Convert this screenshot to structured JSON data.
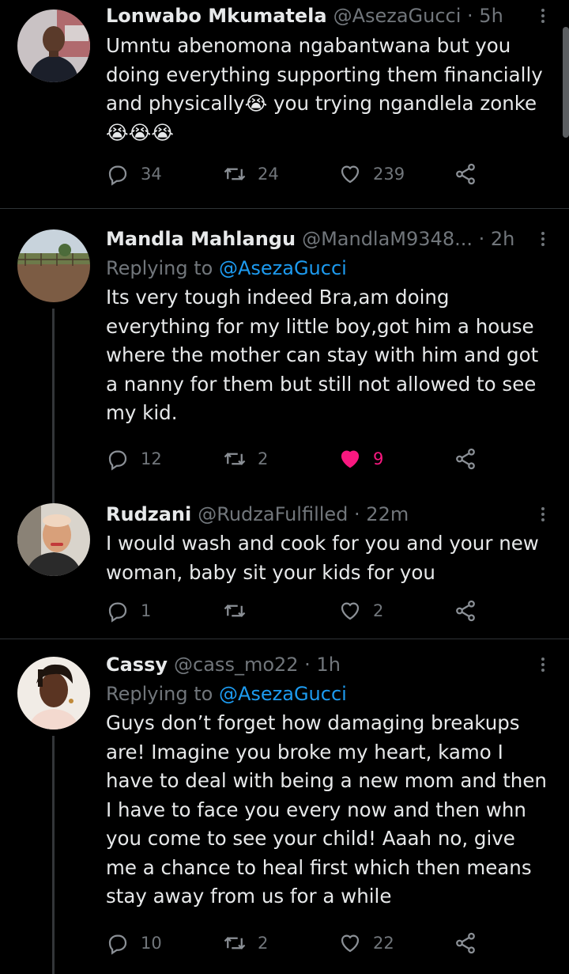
{
  "tweets": [
    {
      "name": "Lonwabo Mkumatela",
      "handle": "@AsezaGucci · 5h",
      "text": "Umntu abenomona ngabantwana but you\ndoing everything supporting them financially\nand physically😭 you trying ngandlela zonke\n😭😭😭",
      "replies": "34",
      "retweets": "24",
      "likes": "239"
    },
    {
      "name": "Mandla Mahlangu",
      "handle": "@MandlaM9348... · 2h",
      "replying_label": "Replying to",
      "replying_to": "@AsezaGucci",
      "text": "Its very tough indeed Bra,am doing\neverything for my little boy,got him a house\nwhere the mother can stay with him and got\na nanny for them but still not allowed to see\nmy kid.",
      "replies": "12",
      "retweets": "2",
      "likes": "9"
    },
    {
      "name": "Rudzani",
      "handle": "@RudzaFulfilled · 22m",
      "text": "I would wash and cook for you and your new\nwoman, baby sit your kids for you",
      "replies": "1",
      "retweets": "",
      "likes": "2"
    },
    {
      "name": "Cassy",
      "handle": "@cass_mo22 · 1h",
      "replying_label": "Replying to",
      "replying_to": "@AsezaGucci",
      "text": "Guys don’t forget how damaging breakups\nare! Imagine you broke my heart, kamo I\nhave to deal with being a new mom and then\nI have to face you every now and then whn\nyou come to see your child! Aaah no, give\nme a chance to heal first which then means\nstay away from us for a while",
      "replies": "10",
      "retweets": "2",
      "likes": "22"
    }
  ],
  "colors": {
    "background": "#000000",
    "text": "#e7e9ea",
    "muted": "#71767b",
    "link": "#1d9bf0",
    "like_active": "#f91880"
  },
  "icons": [
    "reply-icon",
    "retweet-icon",
    "like-icon",
    "share-icon",
    "more-options-icon"
  ]
}
